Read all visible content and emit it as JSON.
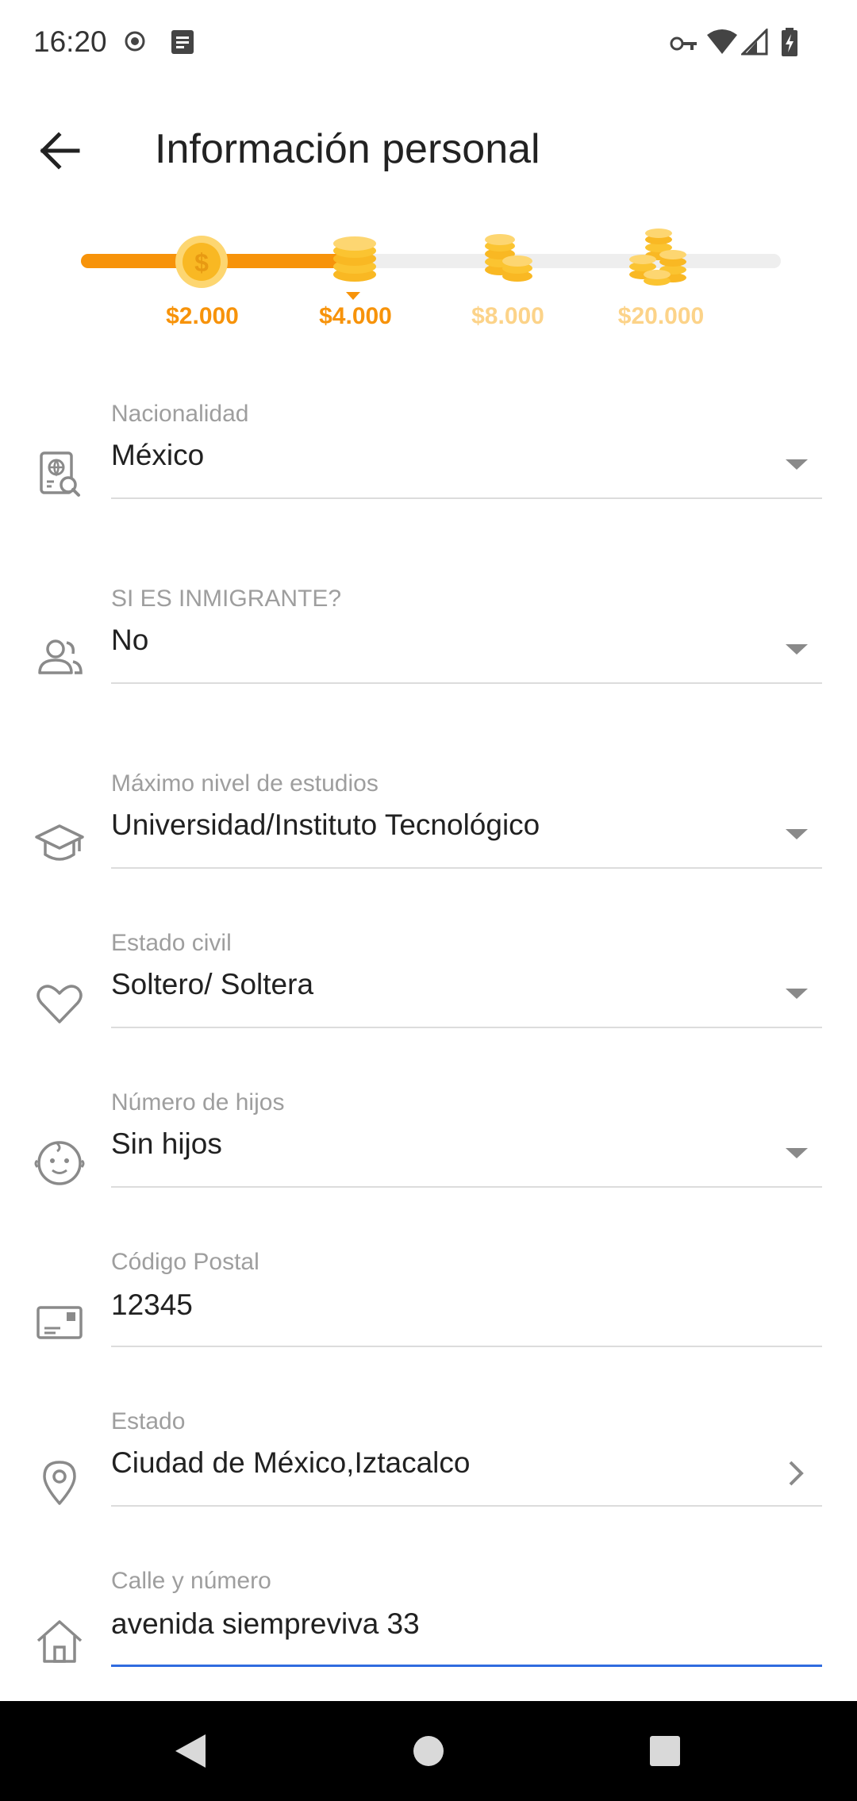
{
  "status_bar": {
    "time": "16:20",
    "icons": [
      "record-icon",
      "notes-icon",
      "vpn-key-icon",
      "wifi-icon",
      "signal-icon",
      "battery-charging-icon"
    ]
  },
  "app_bar": {
    "title": "Información personal",
    "back_icon": "arrow-left-icon"
  },
  "tiers": {
    "progress_fraction": 0.39,
    "items": [
      {
        "label": "$2.000",
        "icon": "coin-dollar-icon",
        "color": "#f7930a"
      },
      {
        "label": "$4.000",
        "icon": "coin-stack-icon",
        "color": "#f7930a"
      },
      {
        "label": "$8.000",
        "icon": "coin-stacks-icon",
        "color": "#fcd389"
      },
      {
        "label": "$20.000",
        "icon": "coin-pile-icon",
        "color": "#fcd389"
      }
    ]
  },
  "form": {
    "nacionalidad": {
      "label": "Nacionalidad",
      "value": "México",
      "icon": "passport-search-icon"
    },
    "inmigrante": {
      "label": "SI ES INMIGRANTE?",
      "value": "No",
      "icon": "people-icon"
    },
    "estudios": {
      "label": "Máximo nivel de estudios",
      "value": "Universidad/Instituto Tecnológico",
      "icon": "graduation-cap-icon"
    },
    "estado_civil": {
      "label": "Estado civil",
      "value": "Soltero/ Soltera",
      "icon": "heart-icon"
    },
    "hijos": {
      "label": "Número de hijos",
      "value": "Sin hijos",
      "icon": "baby-face-icon"
    },
    "codigo_postal": {
      "label": "Código Postal",
      "value": "12345",
      "icon": "postcard-icon"
    },
    "estado": {
      "label": "Estado",
      "value": "Ciudad de México,Iztacalco",
      "icon": "location-pin-icon"
    },
    "calle": {
      "label": "Calle y número",
      "value": "avenida siempreviva 33",
      "icon": "home-icon"
    }
  },
  "colors": {
    "accent": "#f7930a",
    "accent_light": "#fcd389",
    "active_underline": "#2f6bdf"
  },
  "nav_bar": {
    "icons": [
      "back-triangle-icon",
      "home-circle-icon",
      "recents-square-icon"
    ]
  }
}
